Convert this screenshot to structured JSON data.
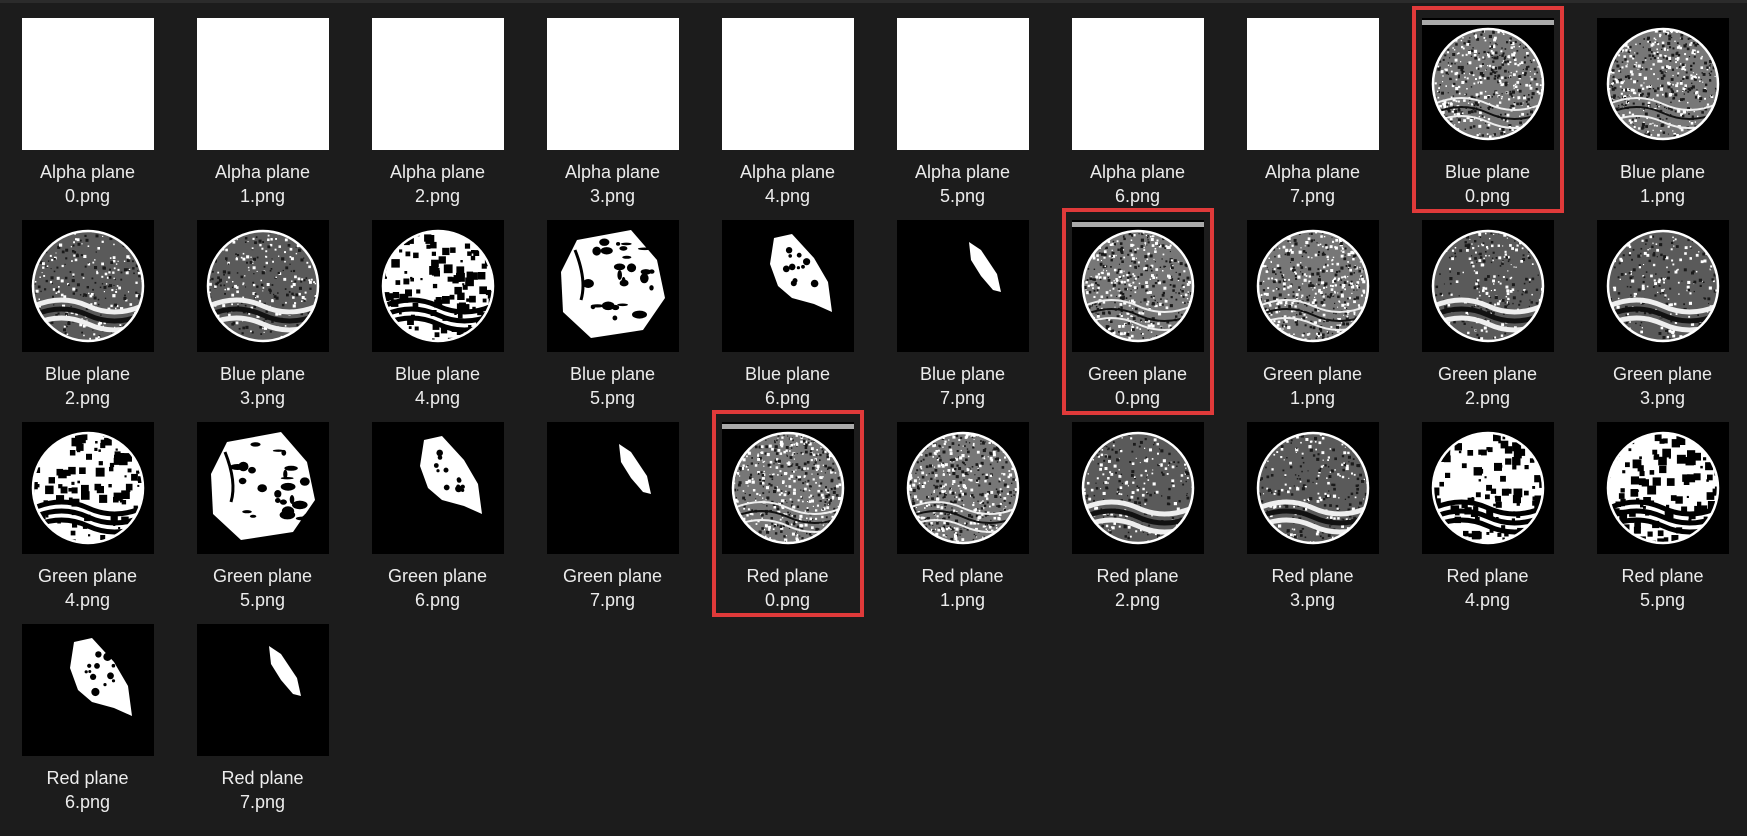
{
  "colors": {
    "background": "#1c1c1c",
    "label_text": "#ececec",
    "highlight_border": "#e03a3a",
    "thumb_black": "#000000",
    "thumb_white": "#ffffff"
  },
  "files": [
    {
      "line1": "Alpha plane",
      "line2": "0.png",
      "thumb": "white"
    },
    {
      "line1": "Alpha plane",
      "line2": "1.png",
      "thumb": "white"
    },
    {
      "line1": "Alpha plane",
      "line2": "2.png",
      "thumb": "white"
    },
    {
      "line1": "Alpha plane",
      "line2": "3.png",
      "thumb": "white"
    },
    {
      "line1": "Alpha plane",
      "line2": "4.png",
      "thumb": "white"
    },
    {
      "line1": "Alpha plane",
      "line2": "5.png",
      "thumb": "white"
    },
    {
      "line1": "Alpha plane",
      "line2": "6.png",
      "thumb": "white"
    },
    {
      "line1": "Alpha plane",
      "line2": "7.png",
      "thumb": "white"
    },
    {
      "line1": "Blue plane",
      "line2": "0.png",
      "thumb": "noise-coin",
      "highlighted": true
    },
    {
      "line1": "Blue plane",
      "line2": "1.png",
      "thumb": "noise-coin"
    },
    {
      "line1": "Blue plane",
      "line2": "2.png",
      "thumb": "textured-coin"
    },
    {
      "line1": "Blue plane",
      "line2": "3.png",
      "thumb": "textured-coin"
    },
    {
      "line1": "Blue plane",
      "line2": "4.png",
      "thumb": "bold-coin"
    },
    {
      "line1": "Blue plane",
      "line2": "5.png",
      "thumb": "partial-coin"
    },
    {
      "line1": "Blue plane",
      "line2": "6.png",
      "thumb": "blob"
    },
    {
      "line1": "Blue plane",
      "line2": "7.png",
      "thumb": "sliver"
    },
    {
      "line1": "Green plane",
      "line2": "0.png",
      "thumb": "noise-coin",
      "highlighted": true
    },
    {
      "line1": "Green plane",
      "line2": "1.png",
      "thumb": "noise-coin"
    },
    {
      "line1": "Green plane",
      "line2": "2.png",
      "thumb": "textured-coin"
    },
    {
      "line1": "Green plane",
      "line2": "3.png",
      "thumb": "textured-coin"
    },
    {
      "line1": "Green plane",
      "line2": "4.png",
      "thumb": "bold-coin"
    },
    {
      "line1": "Green plane",
      "line2": "5.png",
      "thumb": "partial-coin"
    },
    {
      "line1": "Green plane",
      "line2": "6.png",
      "thumb": "blob"
    },
    {
      "line1": "Green plane",
      "line2": "7.png",
      "thumb": "sliver"
    },
    {
      "line1": "Red plane",
      "line2": "0.png",
      "thumb": "noise-coin",
      "highlighted": true
    },
    {
      "line1": "Red plane",
      "line2": "1.png",
      "thumb": "noise-coin"
    },
    {
      "line1": "Red plane",
      "line2": "2.png",
      "thumb": "textured-coin"
    },
    {
      "line1": "Red plane",
      "line2": "3.png",
      "thumb": "textured-coin"
    },
    {
      "line1": "Red plane",
      "line2": "4.png",
      "thumb": "bold-coin"
    },
    {
      "line1": "Red plane",
      "line2": "5.png",
      "thumb": "bold-coin"
    },
    {
      "line1": "Red plane",
      "line2": "6.png",
      "thumb": "blob"
    },
    {
      "line1": "Red plane",
      "line2": "7.png",
      "thumb": "sliver"
    }
  ]
}
